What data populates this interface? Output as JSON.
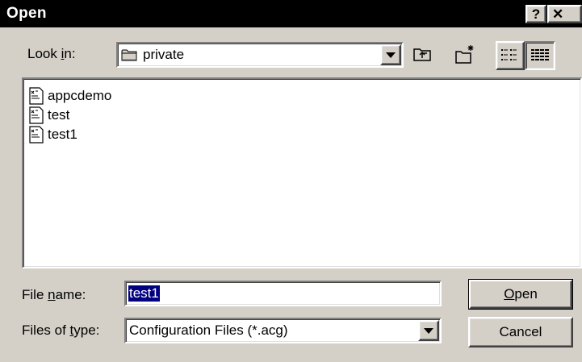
{
  "window": {
    "title": "Open",
    "help_glyph": "?",
    "close_glyph": "✕"
  },
  "lookin": {
    "label_pre": "Look ",
    "label_key": "i",
    "label_post": "n:",
    "folder_icon": "folder-icon",
    "value": "private"
  },
  "toolbar": {
    "up_icon": "up-one-level-icon",
    "new_folder_icon": "new-folder-icon",
    "list_icon": "list-view-icon",
    "details_icon": "details-view-icon"
  },
  "files": [
    {
      "name": "appcdemo",
      "icon": "configuration-file-icon"
    },
    {
      "name": "test",
      "icon": "configuration-file-icon"
    },
    {
      "name": "test1",
      "icon": "configuration-file-icon"
    }
  ],
  "filename": {
    "label_pre": "File ",
    "label_key": "n",
    "label_post": "ame:",
    "value": "test1"
  },
  "filetype": {
    "label_pre": "Files of ",
    "label_key": "t",
    "label_post": "ype:",
    "value": "Configuration Files (*.acg)"
  },
  "buttons": {
    "open_key": "O",
    "open_rest": "pen",
    "cancel": "Cancel"
  },
  "colors": {
    "face": "#d4d0c8",
    "titlebar": "#000000",
    "selection": "#000080"
  }
}
